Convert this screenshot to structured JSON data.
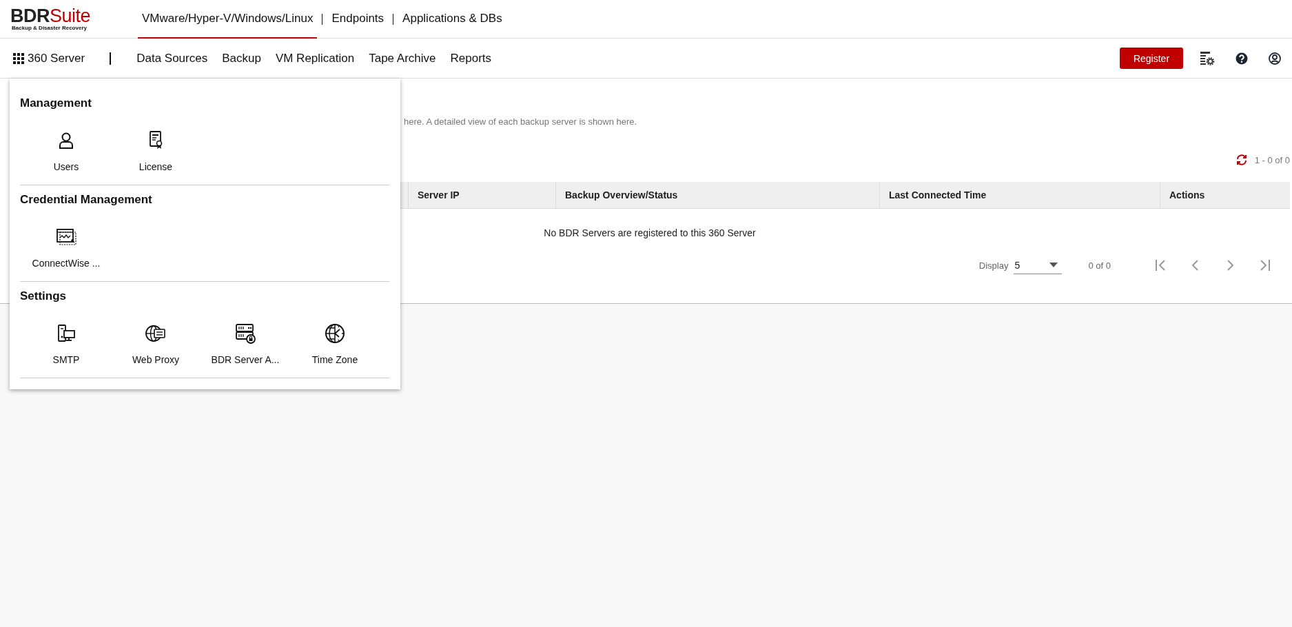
{
  "logo": {
    "brand": "BDR",
    "brand_accent": "Suite",
    "tagline": "Backup & Disaster Recovery"
  },
  "product_tabs": [
    {
      "label": "VMware/Hyper-V/Windows/Linux",
      "selected": true
    },
    {
      "label": "Endpoints",
      "selected": false
    },
    {
      "label": "Applications & DBs",
      "selected": false
    }
  ],
  "app_menu": {
    "label": "360 Server",
    "expanded": true
  },
  "nav": [
    "Data Sources",
    "Backup",
    "VM Replication",
    "Tape Archive",
    "Reports"
  ],
  "register_button": "Register",
  "description": "here. A detailed view of each backup server is shown here.",
  "record_range": "1 - 0 of 0",
  "table": {
    "columns": [
      "Server IP",
      "Backup Overview/Status",
      "Last Connected Time",
      "Actions"
    ],
    "empty_message": "No BDR Servers are registered to this 360 Server"
  },
  "pagination": {
    "display_label": "Display",
    "page_size": "5",
    "page_info": "0 of 0"
  },
  "menu_panel": {
    "sections": [
      {
        "title": "Management",
        "items": [
          {
            "label": "Users",
            "kind": "users"
          },
          {
            "label": "License",
            "kind": "license"
          }
        ]
      },
      {
        "title": "Credential Management",
        "items": [
          {
            "label": "ConnectWise ...",
            "kind": "connectwise"
          }
        ]
      },
      {
        "title": "Settings",
        "items": [
          {
            "label": "SMTP",
            "kind": "smtp"
          },
          {
            "label": "Web Proxy",
            "kind": "proxy"
          },
          {
            "label": "BDR Server A...",
            "kind": "server-lock"
          },
          {
            "label": "Time Zone",
            "kind": "timezone"
          }
        ]
      }
    ]
  }
}
